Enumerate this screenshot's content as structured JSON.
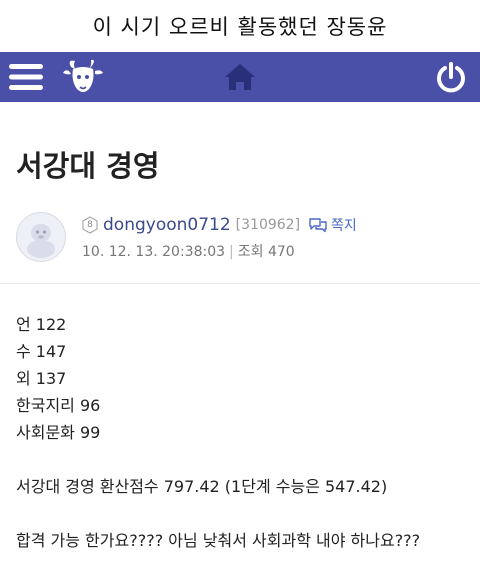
{
  "caption": "이 시기 오르비 활동했던 장동윤",
  "navbar": {
    "background": "#4a4fa8",
    "icons": [
      "hamburger-menu-icon",
      "goat-logo-icon",
      "home-icon",
      "power-icon"
    ]
  },
  "post": {
    "title": "서강대 경영",
    "author": {
      "level": "8",
      "username": "dongyoon0712",
      "user_number": "[310962]",
      "message_label": "쪽지"
    },
    "meta": {
      "datetime": "10. 12. 13. 20:38:03",
      "separator": "|",
      "views_label": "조회",
      "views": "470"
    },
    "body": {
      "lines": [
        "언 122",
        "수 147",
        "외 137",
        "한국지리 96",
        "사회문화 99"
      ],
      "score_line": "서강대 경영 환산점수 797.42 (1단계 수능은 547.42)",
      "question": "합격 가능 한가요???? 아님 낮춰서 사회과학 내야 하나요???"
    }
  }
}
